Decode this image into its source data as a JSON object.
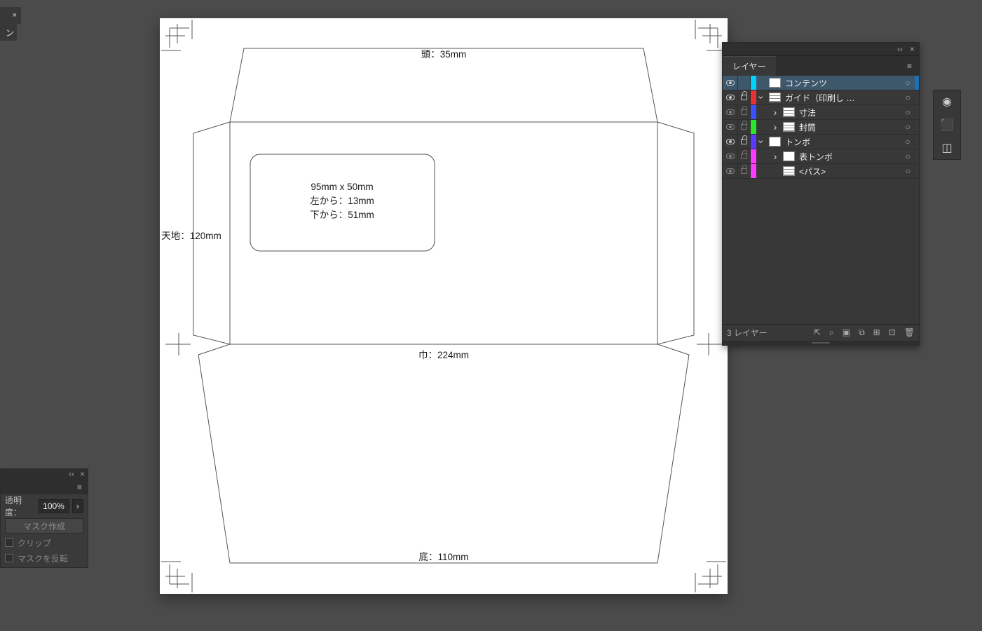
{
  "top_stub": {
    "label": "ン",
    "close": "×"
  },
  "envelope": {
    "window_size": "95mm x 50mm",
    "window_from_left": "左から：13mm",
    "window_from_bottom": "下から：51mm",
    "head": "頭：35mm",
    "height": "天地：120mm",
    "width": "巾：224mm",
    "bottom": "底：110mm"
  },
  "layers_panel": {
    "title": "レイヤー",
    "footer_status": "3 レイヤー",
    "footer_icons": {
      "export": "⇱",
      "find": "⌕",
      "mask": "▣",
      "clip": "⧉",
      "new_sub": "⊞",
      "new": "⊡",
      "trash": "🗑"
    },
    "rows": [
      {
        "id": "contents",
        "name": "コンテンツ",
        "color": "#00d2ff",
        "indent": 0,
        "selected": true,
        "toggle": "none",
        "thumb": "solid",
        "vis": true,
        "locked": false,
        "edge": "#1f6fb5"
      },
      {
        "id": "guide",
        "name": "ガイド（印刷し …",
        "color": "#e63232",
        "indent": 0,
        "toggle": "open",
        "thumb": "lined",
        "vis": true,
        "locked": true
      },
      {
        "id": "dim",
        "name": "寸法",
        "color": "#3a50ff",
        "indent": 1,
        "toggle": "closed",
        "thumb": "lined",
        "vis": true,
        "locked": true,
        "dim": true
      },
      {
        "id": "env",
        "name": "封筒",
        "color": "#29e629",
        "indent": 1,
        "toggle": "closed",
        "thumb": "lined",
        "vis": true,
        "locked": true,
        "dim": true
      },
      {
        "id": "tombo",
        "name": "トンボ",
        "color": "#5a3aff",
        "indent": 0,
        "toggle": "open",
        "thumb": "solid",
        "vis": true,
        "locked": true
      },
      {
        "id": "fronttombo",
        "name": "表トンボ",
        "color": "#ff3aff",
        "indent": 1,
        "toggle": "closed",
        "thumb": "solid",
        "vis": true,
        "locked": true,
        "dim": true
      },
      {
        "id": "path",
        "name": "<パス>",
        "color": "#ff3aff",
        "indent": 1,
        "toggle": "none",
        "thumb": "lined",
        "vis": true,
        "locked": true,
        "dim": true
      }
    ]
  },
  "mini_toolbar": [
    {
      "id": "appearance",
      "glyph": "◉"
    },
    {
      "id": "align",
      "glyph": "⬛"
    },
    {
      "id": "pathfinder",
      "glyph": "◫"
    }
  ],
  "transparency_panel": {
    "title": "透明度：",
    "value": "100%",
    "mask_button": "マスク作成",
    "clip_label": "クリップ",
    "invert_label": "マスクを反転",
    "clip_checked": false,
    "invert_checked": false
  }
}
